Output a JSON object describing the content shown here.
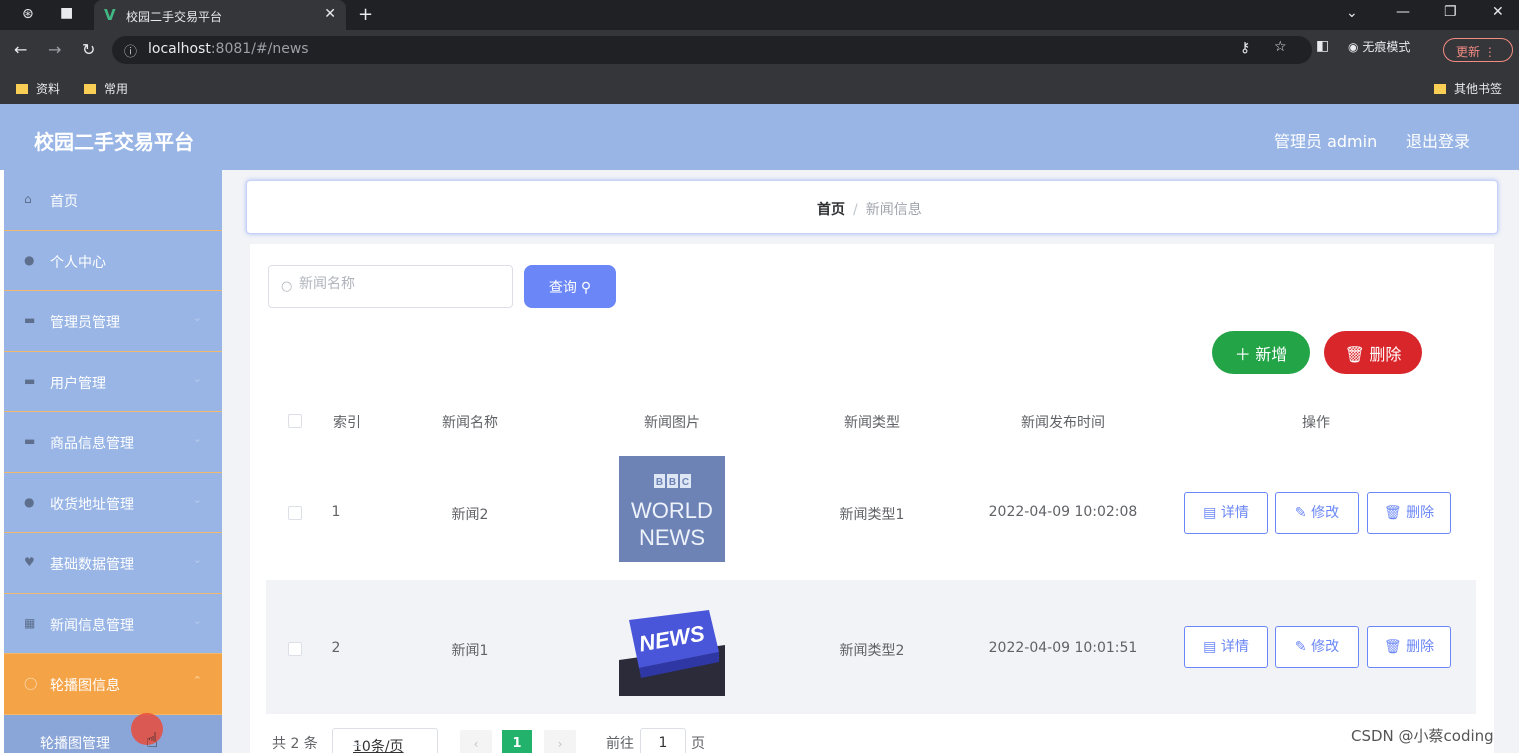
{
  "browser": {
    "tab_title": "校园二手交易平台",
    "url_host": "localhost",
    "url_rest": ":8081/#/news",
    "incognito_label": "无痕模式",
    "update_label": "更新",
    "bookmarks": [
      "资料",
      "常用"
    ],
    "other_bookmarks": "其他书签"
  },
  "header": {
    "title": "校园二手交易平台",
    "admin_label": "管理员 admin",
    "logout_label": "退出登录"
  },
  "sidebar": {
    "items": [
      {
        "label": "首页",
        "icon": "home-icon"
      },
      {
        "label": "个人中心",
        "icon": "user-icon"
      },
      {
        "label": "管理员管理",
        "icon": "admin-icon"
      },
      {
        "label": "用户管理",
        "icon": "users-icon"
      },
      {
        "label": "商品信息管理",
        "icon": "goods-icon"
      },
      {
        "label": "收货地址管理",
        "icon": "address-icon"
      },
      {
        "label": "基础数据管理",
        "icon": "data-icon"
      },
      {
        "label": "新闻信息管理",
        "icon": "news-icon"
      },
      {
        "label": "轮播图信息",
        "icon": "carousel-icon"
      }
    ],
    "sub_item": "轮播图管理"
  },
  "breadcrumb": {
    "home": "首页",
    "separator": "/",
    "current": "新闻信息"
  },
  "search": {
    "placeholder": "新闻名称",
    "query_label": "查询"
  },
  "actions": {
    "add_label": "新增",
    "delete_label": "删除"
  },
  "table": {
    "headers": [
      "索引",
      "新闻名称",
      "新闻图片",
      "新闻类型",
      "新闻发布时间",
      "操作"
    ],
    "rows": [
      {
        "index": "1",
        "name": "新闻2",
        "image": "BBC WORLD NEWS",
        "type": "新闻类型1",
        "time": "2022-04-09 10:02:08"
      },
      {
        "index": "2",
        "name": "新闻1",
        "image": "NEWS",
        "type": "新闻类型2",
        "time": "2022-04-09 10:01:51"
      }
    ],
    "op_detail": "详情",
    "op_edit": "修改",
    "op_delete": "删除"
  },
  "pagination": {
    "total": "共 2 条",
    "page_size": "10条/页",
    "current_page": "1",
    "goto_label": "前往",
    "goto_value": "1",
    "page_suffix": "页"
  },
  "watermark": "CSDN @小蔡coding",
  "colors": {
    "header_bg": "#98b5e6",
    "active_menu": "#f5a347",
    "primary": "#6b87f7",
    "add_green": "#22a447",
    "delete_red": "#d9262b",
    "page_green": "#22b26c"
  }
}
